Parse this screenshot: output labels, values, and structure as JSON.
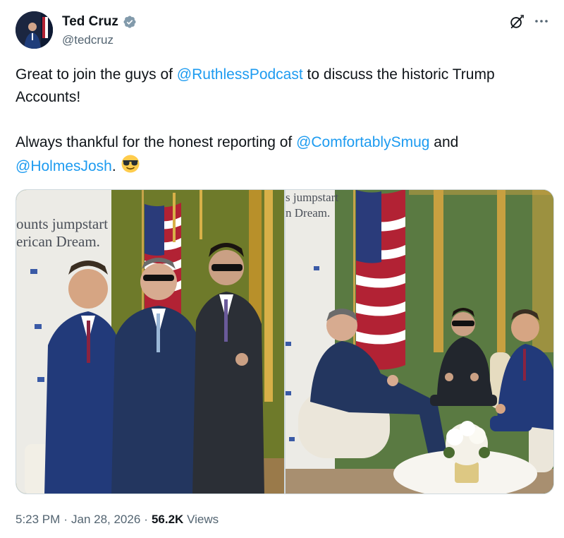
{
  "author": {
    "display_name": "Ted Cruz",
    "handle": "@tedcruz",
    "verified_icon": "verified-badge-icon",
    "avatar_icon": "profile-avatar"
  },
  "header_icons": {
    "grok": "grok-icon",
    "more": "more-options-icon"
  },
  "body": {
    "line1_prefix": "Great to join the guys of ",
    "mention_1": "@RuthlessPodcast",
    "line1_suffix": " to discuss the historic Trump Accounts!",
    "line2_prefix": "Always thankful for the honest reporting of ",
    "mention_2": "@ComfortablySmug",
    "line2_mid": " and ",
    "mention_3": "@HolmesJosh",
    "line2_suffix": ".",
    "emoji": "smiling-face-with-sunglasses"
  },
  "media": {
    "photo_1_banner": [
      "ounts jumpstart",
      "erican Dream."
    ],
    "photo_2_banner": [
      "s jumpstart",
      "n Dream."
    ]
  },
  "footer": {
    "time": "5:23 PM",
    "date": "Jan 28, 2026",
    "views_count": "56.2K",
    "views_label": "Views"
  },
  "colors": {
    "link": "#1d9bf0",
    "muted": "#536471",
    "verified": "#829aab"
  }
}
